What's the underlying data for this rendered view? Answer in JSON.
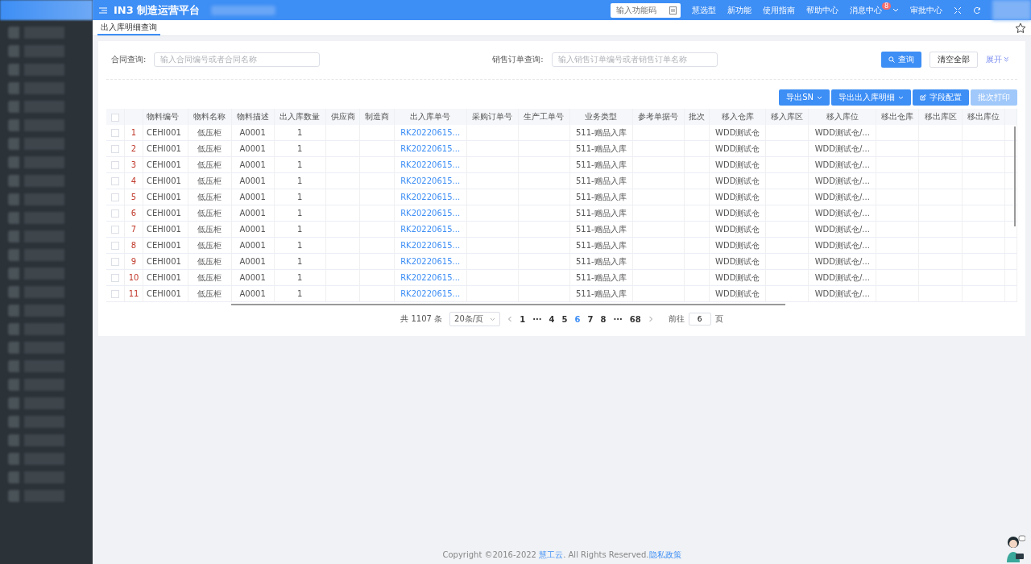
{
  "header": {
    "title": "IN3 制造运营平台",
    "search": {
      "placeholder": "输入功能码"
    },
    "links": [
      {
        "label": "慧选型"
      },
      {
        "label": "新功能"
      },
      {
        "label": "使用指南"
      },
      {
        "label": "帮助中心"
      },
      {
        "label": "消息中心",
        "badge": "8"
      },
      {
        "label": "审批中心"
      }
    ]
  },
  "tabs": [
    {
      "label": "出入库明细查询",
      "selected": true
    }
  ],
  "filters": [
    {
      "label": "合同查询:",
      "placeholder": "输入合同编号或者合同名称"
    },
    {
      "label": "销售订单查询:",
      "placeholder": "输入销售订单编号或者销售订单名称"
    }
  ],
  "filter_buttons": {
    "query": "查询",
    "clear": "清空全部",
    "expand": "展开"
  },
  "toolbar": [
    {
      "label": "导出SN",
      "kind": "dropdown",
      "disabled": false
    },
    {
      "label": "导出出入库明细",
      "kind": "dropdown",
      "disabled": false
    },
    {
      "label": "字段配置",
      "kind": "edit",
      "disabled": false
    },
    {
      "label": "批次打印",
      "kind": "plain",
      "disabled": true
    }
  ],
  "table": {
    "columns": [
      {
        "label": "物料编号"
      },
      {
        "label": "物料名称"
      },
      {
        "label": "物料描述"
      },
      {
        "label": "出入库数量"
      },
      {
        "label": "供应商"
      },
      {
        "label": "制造商"
      },
      {
        "label": "出入库单号",
        "kind": "link"
      },
      {
        "label": "采购订单号"
      },
      {
        "label": "生产工单号"
      },
      {
        "label": "业务类型"
      },
      {
        "label": "参考单据号"
      },
      {
        "label": "批次"
      },
      {
        "label": "移入仓库"
      },
      {
        "label": "移入库区"
      },
      {
        "label": "移入库位"
      },
      {
        "label": "移出仓库"
      },
      {
        "label": "移出库区"
      },
      {
        "label": "移出库位"
      }
    ],
    "select_all_checked": false,
    "rows": [
      {
        "index": "1",
        "checked": false,
        "cells": [
          "CEHI001",
          "低压柜",
          "A0001",
          "1",
          "",
          "",
          "RK20220615...",
          "",
          "",
          "511-赠品入库",
          "",
          "",
          "WDD测试仓",
          "",
          "WDD测试仓/...",
          "",
          "",
          ""
        ]
      },
      {
        "index": "2",
        "checked": false,
        "cells": [
          "CEHI001",
          "低压柜",
          "A0001",
          "1",
          "",
          "",
          "RK20220615...",
          "",
          "",
          "511-赠品入库",
          "",
          "",
          "WDD测试仓",
          "",
          "WDD测试仓/...",
          "",
          "",
          ""
        ]
      },
      {
        "index": "3",
        "checked": false,
        "cells": [
          "CEHI001",
          "低压柜",
          "A0001",
          "1",
          "",
          "",
          "RK20220615...",
          "",
          "",
          "511-赠品入库",
          "",
          "",
          "WDD测试仓",
          "",
          "WDD测试仓/...",
          "",
          "",
          ""
        ]
      },
      {
        "index": "4",
        "checked": false,
        "cells": [
          "CEHI001",
          "低压柜",
          "A0001",
          "1",
          "",
          "",
          "RK20220615...",
          "",
          "",
          "511-赠品入库",
          "",
          "",
          "WDD测试仓",
          "",
          "WDD测试仓/...",
          "",
          "",
          ""
        ]
      },
      {
        "index": "5",
        "checked": false,
        "cells": [
          "CEHI001",
          "低压柜",
          "A0001",
          "1",
          "",
          "",
          "RK20220615...",
          "",
          "",
          "511-赠品入库",
          "",
          "",
          "WDD测试仓",
          "",
          "WDD测试仓/...",
          "",
          "",
          ""
        ]
      },
      {
        "index": "6",
        "checked": false,
        "cells": [
          "CEHI001",
          "低压柜",
          "A0001",
          "1",
          "",
          "",
          "RK20220615...",
          "",
          "",
          "511-赠品入库",
          "",
          "",
          "WDD测试仓",
          "",
          "WDD测试仓/...",
          "",
          "",
          ""
        ]
      },
      {
        "index": "7",
        "checked": false,
        "cells": [
          "CEHI001",
          "低压柜",
          "A0001",
          "1",
          "",
          "",
          "RK20220615...",
          "",
          "",
          "511-赠品入库",
          "",
          "",
          "WDD测试仓",
          "",
          "WDD测试仓/...",
          "",
          "",
          ""
        ]
      },
      {
        "index": "8",
        "checked": false,
        "cells": [
          "CEHI001",
          "低压柜",
          "A0001",
          "1",
          "",
          "",
          "RK20220615...",
          "",
          "",
          "511-赠品入库",
          "",
          "",
          "WDD测试仓",
          "",
          "WDD测试仓/...",
          "",
          "",
          ""
        ]
      },
      {
        "index": "9",
        "checked": false,
        "cells": [
          "CEHI001",
          "低压柜",
          "A0001",
          "1",
          "",
          "",
          "RK20220615...",
          "",
          "",
          "511-赠品入库",
          "",
          "",
          "WDD测试仓",
          "",
          "WDD测试仓/...",
          "",
          "",
          ""
        ]
      },
      {
        "index": "10",
        "checked": false,
        "cells": [
          "CEHI001",
          "低压柜",
          "A0001",
          "1",
          "",
          "",
          "RK20220615...",
          "",
          "",
          "511-赠品入库",
          "",
          "",
          "WDD测试仓",
          "",
          "WDD测试仓/...",
          "",
          "",
          ""
        ]
      },
      {
        "index": "11",
        "checked": false,
        "cells": [
          "CEHI001",
          "低压柜",
          "A0001",
          "1",
          "",
          "",
          "RK20220615...",
          "",
          "",
          "511-赠品入库",
          "",
          "",
          "WDD测试仓",
          "",
          "WDD测试仓/...",
          "",
          "",
          ""
        ]
      }
    ]
  },
  "pagination": {
    "total": "共 1107 条",
    "page_size": "20条/页",
    "pages": [
      {
        "label": "1",
        "selected": false
      },
      {
        "label": "···",
        "selected": false
      },
      {
        "label": "4",
        "selected": false
      },
      {
        "label": "5",
        "selected": false
      },
      {
        "label": "6",
        "selected": true
      },
      {
        "label": "7",
        "selected": false
      },
      {
        "label": "8",
        "selected": false
      },
      {
        "label": "···",
        "selected": false
      },
      {
        "label": "68",
        "selected": false
      }
    ],
    "goto_label": "前往",
    "goto_value": "6",
    "goto_suffix": "页"
  },
  "footer": {
    "text": "Copyright ©2016-2022",
    "company": "慧工云",
    "rights": ". All Rights Reserved.",
    "privacy": "隐私政策"
  }
}
